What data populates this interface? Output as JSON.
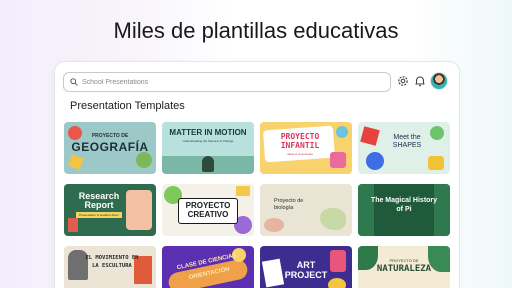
{
  "headline": "Miles de plantillas educativas",
  "search": {
    "placeholder": "School Presentations"
  },
  "section_title": "Presentation Templates",
  "icons": {
    "search": "search-icon",
    "settings": "gear-icon",
    "notifications": "bell-icon",
    "avatar": "avatar"
  },
  "templates": [
    {
      "top": "PROYECTO DE",
      "title": "GEOGRAFÍA",
      "sub": ""
    },
    {
      "title": "MATTER IN MOTION",
      "sub": "Understanding the Science of Change"
    },
    {
      "title": "PROYECTO INFANTIL",
      "sub": "ideas & propuestas"
    },
    {
      "title": "Meet the SHAPES",
      "sub": ""
    },
    {
      "title": "Research Report",
      "sub": "Presentation to Heather Alvez"
    },
    {
      "title": "PROYECTO CREATIVO",
      "sub": ""
    },
    {
      "title": "Proyecto de biología",
      "sub": ""
    },
    {
      "title": "The Magical History of Pi",
      "sub": ""
    },
    {
      "title": "EL MOVIMIENTO EN LA ESCULTURA",
      "sub": ""
    },
    {
      "title": "CLASE DE CIENCIAS ORIENTACIÓN",
      "sub": ""
    },
    {
      "title": "ART PROJECT",
      "sub": ""
    },
    {
      "top": "PROYECTO DE",
      "title": "NATURALEZA",
      "sub": ""
    }
  ],
  "colors": {
    "accent_purple": "#7d2ae8",
    "card_geografia": "#9cc9c7",
    "card_matter": "#b8e0dc",
    "card_infantil": "#f7d26d",
    "card_shapes": "#dff0e8",
    "card_research": "#2f6b4f",
    "card_creativo": "#f4f1e8",
    "card_biologia": "#e9e4d4",
    "card_pi": "#1f5b3a",
    "card_escultura": "#ece5d6",
    "card_ciencias": "#5a2fb0",
    "card_art": "#3c2d8f",
    "card_naturaleza": "#f3ebd4"
  }
}
